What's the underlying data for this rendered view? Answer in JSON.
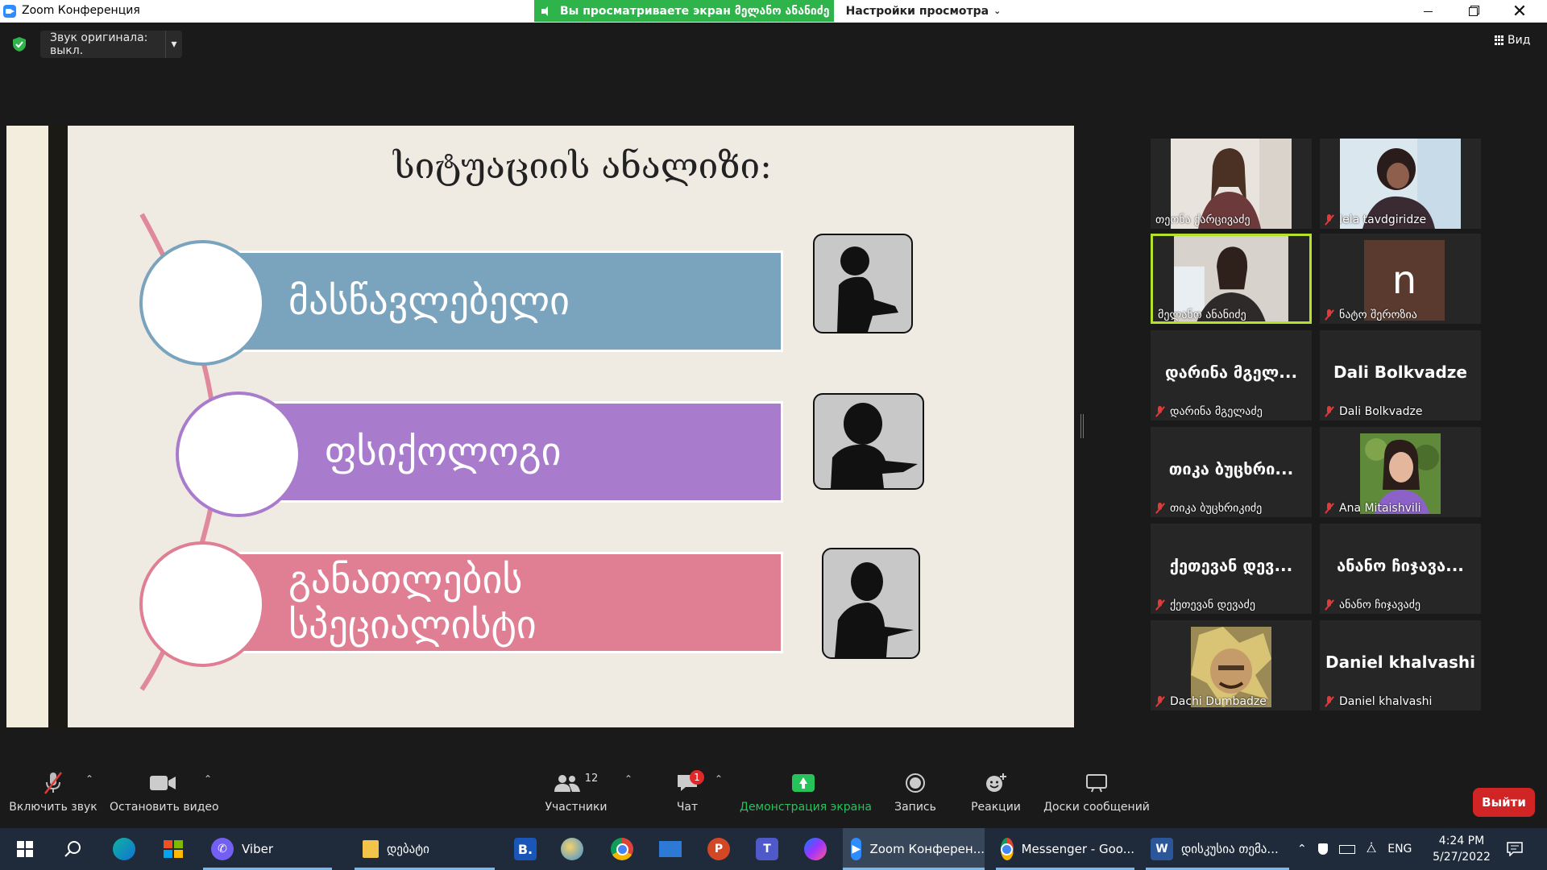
{
  "window": {
    "title": "Zoom Конференция",
    "share_banner": "Вы просматриваете экран მელანო ანანიძე",
    "view_options": "Настройки просмотра"
  },
  "topbar": {
    "original_sound": "Звук оригинала: выкл.",
    "view_label": "Вид"
  },
  "slide": {
    "title": "სიტუაციის ანალიზი:",
    "items": [
      {
        "label": "მასწავლებელი",
        "color": "#7aa3be"
      },
      {
        "label": "ფსიქოლოგი",
        "color": "#a97bcd"
      },
      {
        "label": "განათლების სპეციალისტი",
        "color": "#e07f94"
      }
    ],
    "connector_color": "#e0899b"
  },
  "participants": [
    {
      "name": "თეონა ქარცივაძე",
      "type": "video",
      "muted": false
    },
    {
      "name": "Iela tavdgiridze",
      "type": "video",
      "muted": true
    },
    {
      "name": "მელანო ანანიძე",
      "type": "video",
      "muted": false,
      "active": true
    },
    {
      "name": "ნატო შეროზია",
      "type": "avatar",
      "avatar_letter": "n",
      "muted": true
    },
    {
      "name": "დარინა მგელაძე",
      "display": "დარინა მგელ...",
      "type": "name",
      "muted": true
    },
    {
      "name": "Dali Bolkvadze",
      "display": "Dali Bolkvadze",
      "type": "name",
      "muted": true
    },
    {
      "name": "თიკა ბუცხრიკიძე",
      "display": "თიკა ბუცხრი...",
      "type": "name",
      "muted": true
    },
    {
      "name": "Ana Mitaishvili",
      "type": "photo",
      "muted": true
    },
    {
      "name": "ქეთევან დევაძე",
      "display": "ქეთევან დევ...",
      "type": "name",
      "muted": true
    },
    {
      "name": "ანანო ჩიჯავაძე",
      "display": "ანანო ჩიჯავა...",
      "type": "name",
      "muted": true
    },
    {
      "name": "Dachi Dumbadze",
      "type": "photo",
      "muted": true
    },
    {
      "name": "Daniel khalvashi",
      "display": "Daniel khalvashi",
      "type": "name",
      "muted": true
    }
  ],
  "controls": {
    "unmute": "Включить звук",
    "stop_video": "Остановить видео",
    "participants_label": "Участники",
    "participants_count": "12",
    "chat_label": "Чат",
    "chat_badge": "1",
    "share_label": "Демонстрация экрана",
    "record_label": "Запись",
    "reactions_label": "Реакции",
    "whiteboard_label": "Доски сообщений",
    "leave_label": "Выйти"
  },
  "taskbar": {
    "items": [
      {
        "label": "Viber"
      },
      {
        "label": "დებატი"
      },
      {
        "label": "B."
      },
      {
        "label": "Zoom Конферен..."
      },
      {
        "label": "Messenger - Goo..."
      },
      {
        "label": "დისკუსია თემა..."
      }
    ],
    "lang": "ENG",
    "time": "4:24 PM",
    "date": "5/27/2022"
  }
}
